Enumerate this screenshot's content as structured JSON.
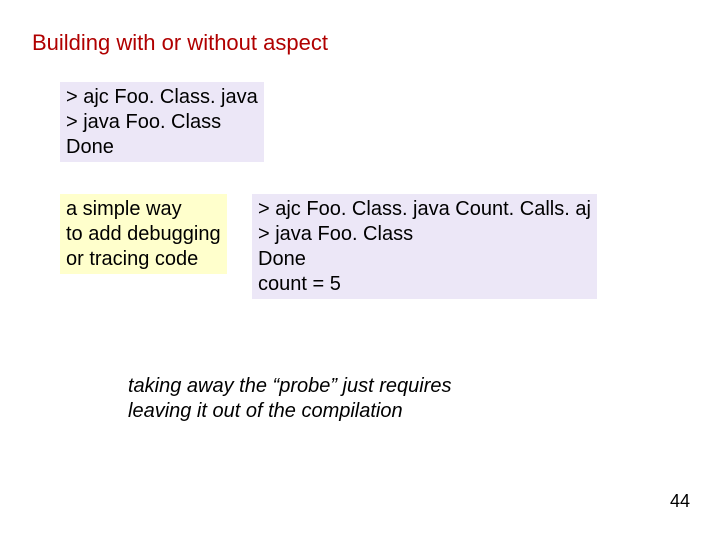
{
  "title": "Building with or without aspect",
  "code1": {
    "line1": "> ajc Foo. Class. java",
    "line2": "> java Foo. Class",
    "line3": "Done"
  },
  "note": {
    "line1": "a simple way",
    "line2": "to add debugging",
    "line3": "or tracing code"
  },
  "code2": {
    "line1": "> ajc Foo. Class. java Count. Calls. aj",
    "line2": "> java Foo. Class",
    "line3": "Done",
    "line4": "count = 5"
  },
  "footer": {
    "line1": "taking away the “probe” just requires",
    "line2": "leaving it out of the compilation"
  },
  "page": "44"
}
